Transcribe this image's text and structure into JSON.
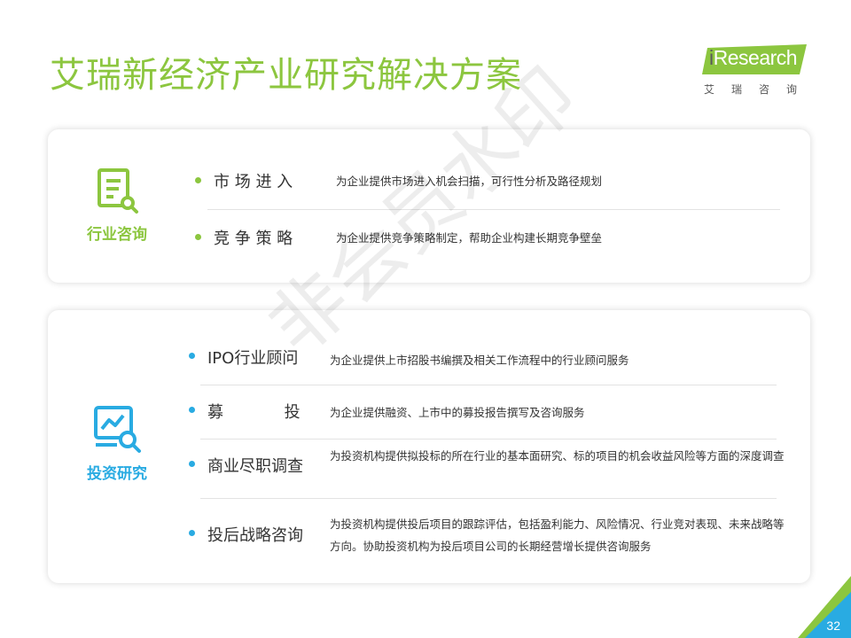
{
  "title": "艾瑞新经济产业研究解决方案",
  "logo": {
    "i": "i",
    "brand": "Research",
    "subtitle": "艾瑞咨询"
  },
  "colors": {
    "green": "#8cc63f",
    "blue": "#29abe2",
    "text": "#333333",
    "divider": "#e3e3e3"
  },
  "sections": [
    {
      "category": "行业咨询",
      "icon": "document-search-icon",
      "items": [
        {
          "name": "市 场 进 入",
          "desc": "为企业提供市场进入机会扫描，可行性分析及路径规划"
        },
        {
          "name": "竞 争 策 略",
          "desc": "为企业提供竞争策略制定，帮助企业构建长期竞争壁垒"
        }
      ]
    },
    {
      "category": "投资研究",
      "icon": "chart-search-icon",
      "items": [
        {
          "name": "IPO行业顾问",
          "desc": "为企业提供上市招股书编撰及相关工作流程中的行业顾问服务"
        },
        {
          "name": "募            投",
          "desc": "为企业提供融资、上市中的募投报告撰写及咨询服务"
        },
        {
          "name": "商业尽职调查",
          "desc": "为投资机构提供拟投标的所在行业的基本面研究、标的项目的机会收益风险等方面的深度调查"
        },
        {
          "name": "投后战略咨询",
          "desc": "为投资机构提供投后项目的跟踪评估，包括盈利能力、风险情况、行业竞对表现、未来战略等方向。协助投资机构为投后项目公司的长期经营增长提供咨询服务"
        }
      ]
    }
  ],
  "watermark": "非会员水印",
  "page_number": "32"
}
